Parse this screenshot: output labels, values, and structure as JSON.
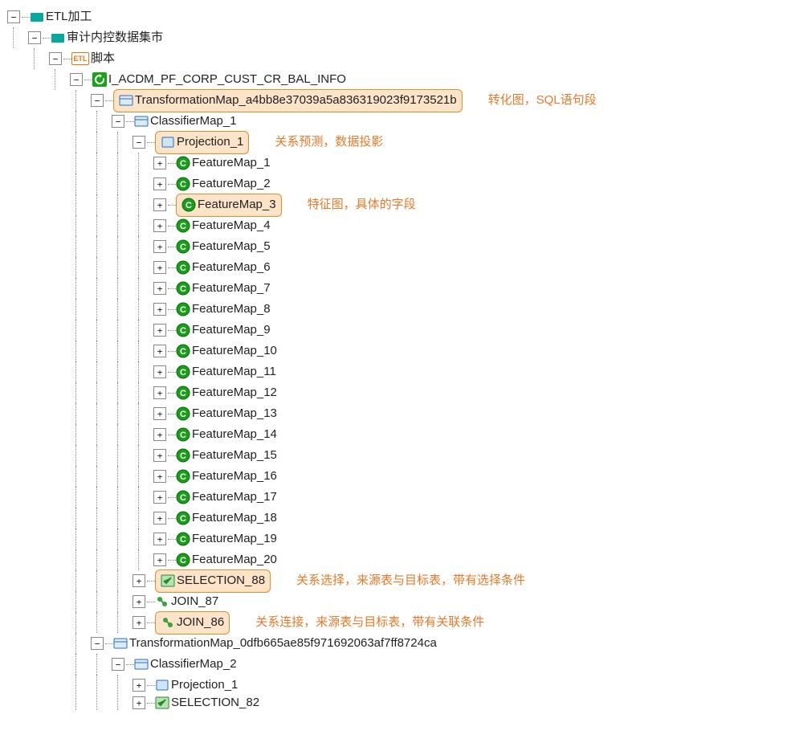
{
  "tree": {
    "root": "ETL加工",
    "level1": "审计内控数据集市",
    "level2": "脚本",
    "level2_icon_text": "ETL",
    "level3": "I_ACDM_PF_CORP_CUST_CR_BAL_INFO",
    "tmap1": "TransformationMap_a4bb8e37039a5a836319023f9173521b",
    "clf1": "ClassifierMap_1",
    "proj1": "Projection_1",
    "features": [
      "FeatureMap_1",
      "FeatureMap_2",
      "FeatureMap_3",
      "FeatureMap_4",
      "FeatureMap_5",
      "FeatureMap_6",
      "FeatureMap_7",
      "FeatureMap_8",
      "FeatureMap_9",
      "FeatureMap_10",
      "FeatureMap_11",
      "FeatureMap_12",
      "FeatureMap_13",
      "FeatureMap_14",
      "FeatureMap_15",
      "FeatureMap_16",
      "FeatureMap_17",
      "FeatureMap_18",
      "FeatureMap_19",
      "FeatureMap_20"
    ],
    "sel88": "SELECTION_88",
    "join87": "JOIN_87",
    "join86": "JOIN_86",
    "tmap2": "TransformationMap_0dfb665ae85f971692063af7ff8724ca",
    "clf2": "ClassifierMap_2",
    "proj2": "Projection_1",
    "sel82": "SELECTION_82"
  },
  "annot": {
    "tmap": "转化图，SQL语句段",
    "proj": "关系预测，数据投影",
    "feat": "特征图，具体的字段",
    "sel": "关系选择，来源表与目标表，带有选择条件",
    "join": "关系连接，来源表与目标表，带有关联条件"
  }
}
